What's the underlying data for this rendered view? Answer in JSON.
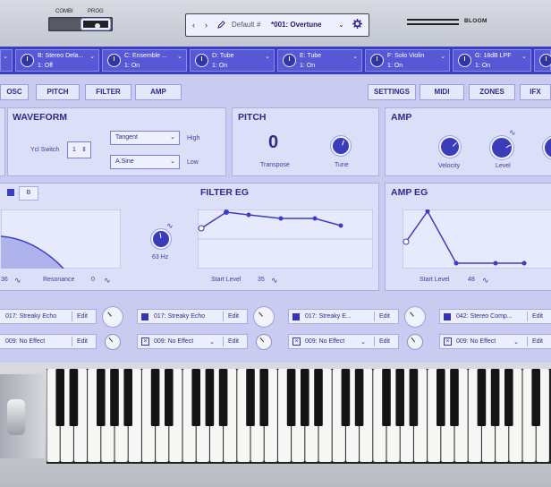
{
  "header": {
    "mode_labels": [
      "COMBI",
      "PROG"
    ],
    "display": {
      "nav_back": "‹",
      "nav_fwd": "›",
      "edit_icon": "pencil-icon",
      "bank": "Default",
      "bank_mark": "#",
      "program": "*001: Overtune",
      "gear_icon": "gear-icon"
    },
    "brand": "BLOOM"
  },
  "slots": [
    {
      "name": "B: Stereo Dela...",
      "value": "1: Off"
    },
    {
      "name": "C: Ensemble ...",
      "value": "1: On"
    },
    {
      "name": "D: Tube",
      "value": "1: On"
    },
    {
      "name": "E: Tube",
      "value": "1: On"
    },
    {
      "name": "F: Solo Violin",
      "value": "1: On"
    },
    {
      "name": "G: 18dB LPF",
      "value": "1: On"
    }
  ],
  "tabs_left": [
    "OSC",
    "PITCH",
    "FILTER",
    "AMP"
  ],
  "tabs_right": [
    "SETTINGS",
    "MIDI",
    "ZONES",
    "IFX"
  ],
  "waveform": {
    "title": "WAVEFORM",
    "switch_label": "Ycl Switch",
    "switch_value": "1",
    "high_select": "Tangent",
    "high_label": "High",
    "low_select": "A.Sine",
    "low_label": "Low"
  },
  "pitch": {
    "title": "PITCH",
    "transpose_value": "0",
    "transpose_label": "Transpose",
    "tune_label": "Tune"
  },
  "amp": {
    "title": "AMP",
    "velocity_label": "Velocity",
    "level_label": "Level"
  },
  "osc_tabs": {
    "b_label": "B"
  },
  "filter": {
    "cutoff_value": "36",
    "resonance_label": "Resonance",
    "resonance_value": "0",
    "freq_value": "63 Hz"
  },
  "filter_eg": {
    "title": "FILTER EG",
    "start_label": "Start Level",
    "start_value": "35"
  },
  "amp_eg": {
    "title": "AMP EG",
    "start_label": "Start Level",
    "start_value": "48"
  },
  "fx": {
    "edit_label": "Edit",
    "rows": [
      [
        "017: Streaky Echo",
        "017: Streaky Echo",
        "017: Streaky E...",
        "042: Stereo Comp..."
      ],
      [
        "009: No Effect",
        "009: No Effect",
        "009: No Effect",
        "009: No Effect"
      ]
    ]
  },
  "colors": {
    "accent": "#3b3dc4",
    "panel": "#dcdff8",
    "text": "#2a2c8c"
  }
}
